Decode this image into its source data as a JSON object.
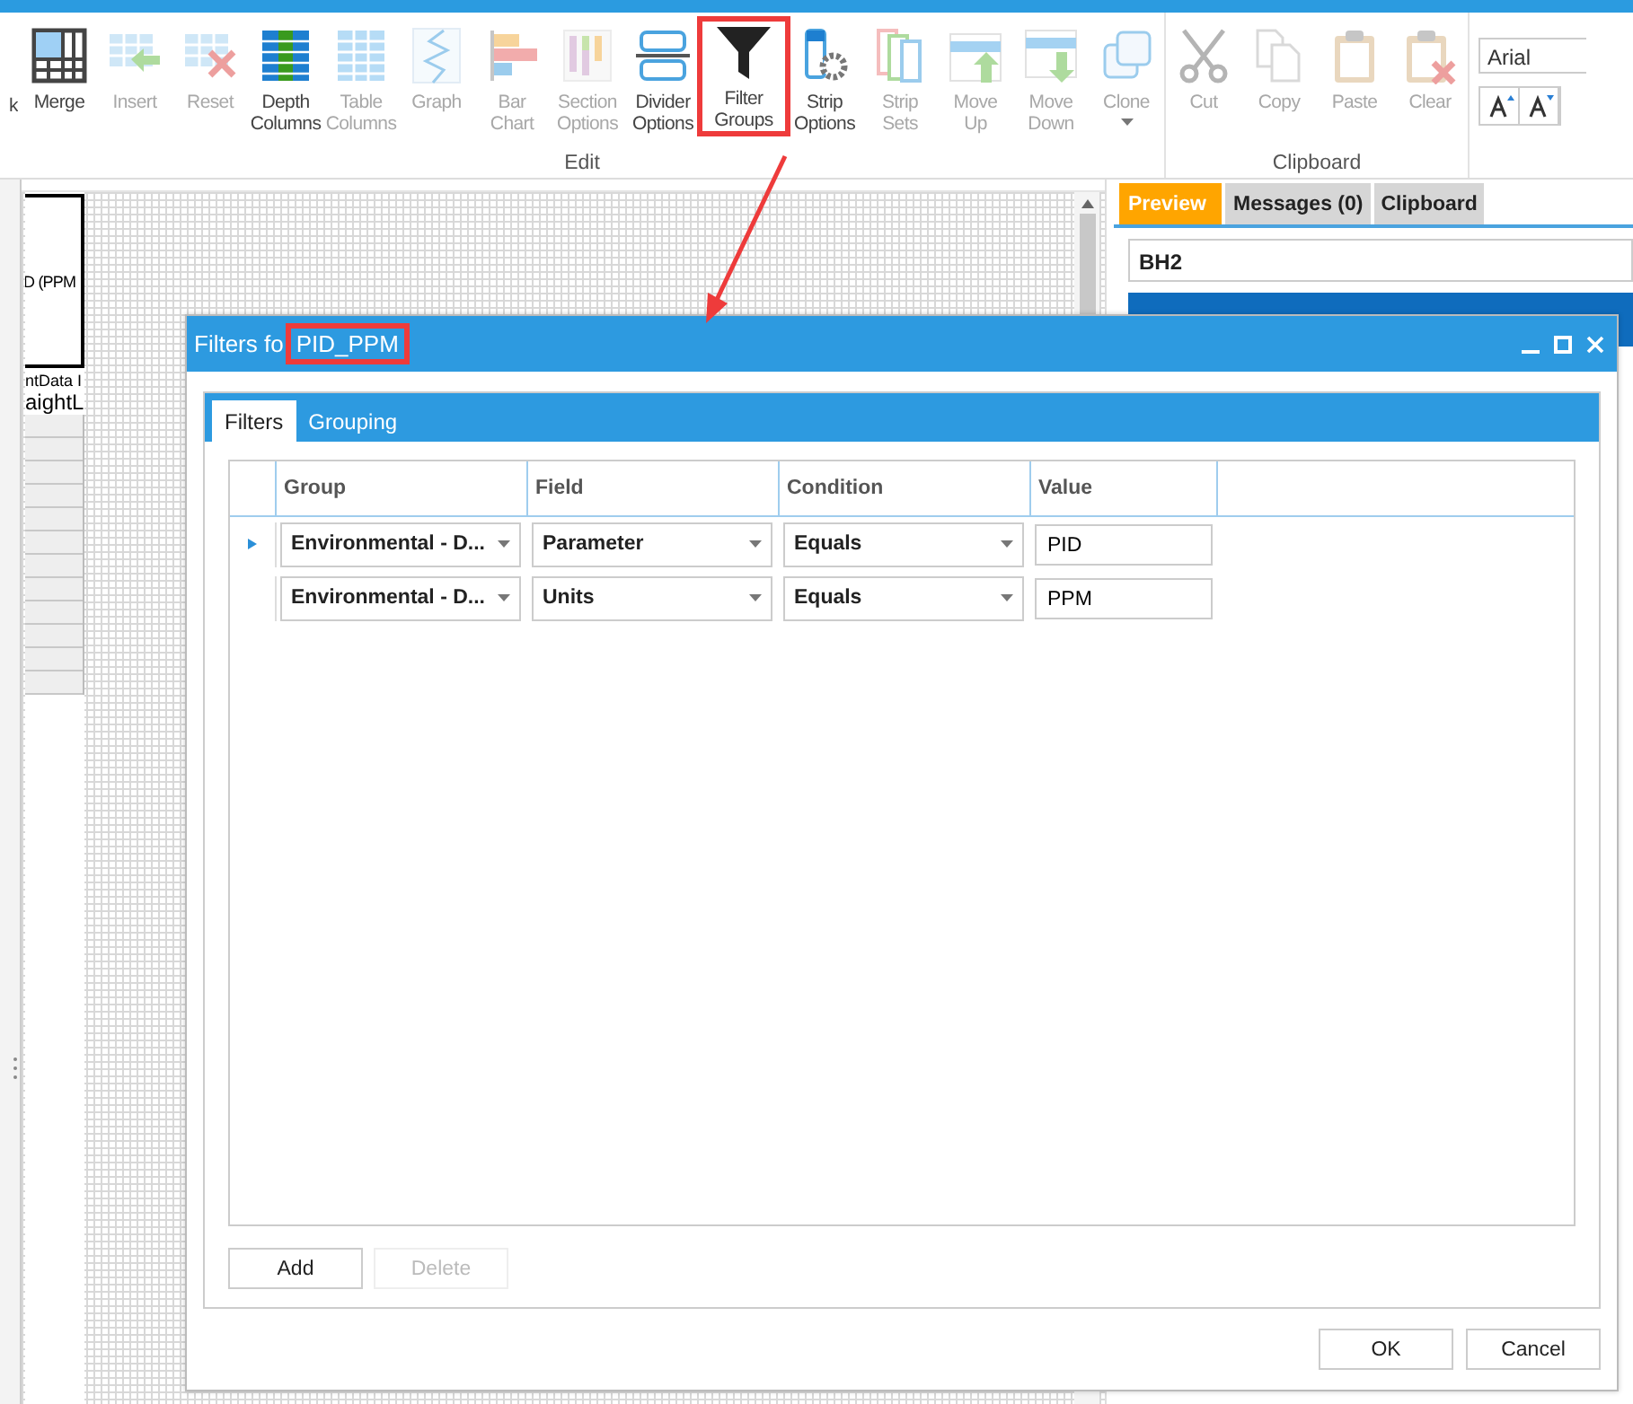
{
  "ribbon": {
    "groups": [
      {
        "label": "Edit",
        "buttons": [
          {
            "label": "k",
            "kind": "partial",
            "disabled": false,
            "highlighted": false
          },
          {
            "label": "Merge",
            "kind": "merge",
            "disabled": false,
            "highlighted": false
          },
          {
            "label": "Insert",
            "kind": "insert",
            "disabled": true,
            "highlighted": false
          },
          {
            "label": "Reset",
            "kind": "reset",
            "disabled": true,
            "highlighted": false
          },
          {
            "label": "Depth Columns",
            "kind": "depth",
            "disabled": false,
            "highlighted": false
          },
          {
            "label": "Table Columns",
            "kind": "table",
            "disabled": true,
            "highlighted": false
          },
          {
            "label": "Graph",
            "kind": "graph",
            "disabled": true,
            "highlighted": false
          },
          {
            "label": "Bar Chart",
            "kind": "bar",
            "disabled": true,
            "highlighted": false
          },
          {
            "label": "Section Options",
            "kind": "section",
            "disabled": true,
            "highlighted": false
          },
          {
            "label": "Divider Options",
            "kind": "divider",
            "disabled": false,
            "highlighted": false
          },
          {
            "label": "Filter Groups",
            "kind": "filter",
            "disabled": false,
            "highlighted": true
          },
          {
            "label": "Strip Options",
            "kind": "strip",
            "disabled": false,
            "highlighted": false
          },
          {
            "label": "Strip Sets",
            "kind": "sets",
            "disabled": true,
            "highlighted": false
          },
          {
            "label": "Move Up",
            "kind": "up",
            "disabled": true,
            "highlighted": false
          },
          {
            "label": "Move Down",
            "kind": "down",
            "disabled": true,
            "highlighted": false
          },
          {
            "label": "Clone",
            "kind": "clone",
            "disabled": true,
            "highlighted": false
          }
        ]
      },
      {
        "label": "Clipboard",
        "buttons": [
          {
            "label": "Cut",
            "kind": "cut",
            "disabled": true,
            "highlighted": false
          },
          {
            "label": "Copy",
            "kind": "copy",
            "disabled": true,
            "highlighted": false
          },
          {
            "label": "Paste",
            "kind": "paste",
            "disabled": true,
            "highlighted": false
          },
          {
            "label": "Clear",
            "kind": "clear",
            "disabled": true,
            "highlighted": false
          }
        ]
      }
    ],
    "font": {
      "value": "Arial"
    }
  },
  "canvas": {
    "column_header": "D (PPM",
    "labels": [
      "ntData I",
      "aightL"
    ]
  },
  "right_panel": {
    "tabs": [
      {
        "label": "Preview",
        "selected": true
      },
      {
        "label": "Messages (0)",
        "selected": false
      },
      {
        "label": "Clipboard",
        "selected": false
      }
    ],
    "field": {
      "value": "BH2"
    }
  },
  "dialog": {
    "title": "Filters fo",
    "title_highlight": "PID_PPM",
    "tabs": [
      {
        "label": "Filters",
        "selected": true
      },
      {
        "label": "Grouping",
        "selected": false
      }
    ],
    "columns": [
      "Group",
      "Field",
      "Condition",
      "Value"
    ],
    "rows": [
      {
        "current": true,
        "group": "Environmental - D...",
        "field": "Parameter",
        "condition": "Equals",
        "value": "PID"
      },
      {
        "current": false,
        "group": "Environmental - D...",
        "field": "Units",
        "condition": "Equals",
        "value": "PPM"
      }
    ],
    "buttons": [
      {
        "label": "Add",
        "disabled": false
      },
      {
        "label": "Delete",
        "disabled": true
      }
    ],
    "footer": [
      "OK",
      "Cancel"
    ]
  }
}
